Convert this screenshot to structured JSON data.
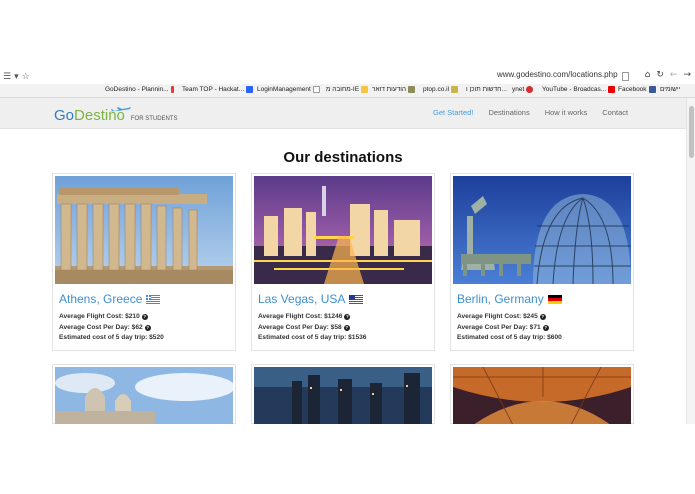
{
  "browser": {
    "url": "www.godestino.com/locations.php",
    "bookmarks": [
      "GoDestino - Plannin...",
      "Team TOP - Hackat...",
      "LoginManagement",
      "מחובה מ-IE",
      "הודעות דואר",
      "ptop.co.il",
      "חדשות תוכן ו...",
      "ynet",
      "YouTube - Broadcas...",
      "Facebook",
      "יישומים"
    ]
  },
  "nav": {
    "logo_go": "Go",
    "logo_destino": "Destino",
    "logo_tagline": "FOR STUDENTS",
    "links": [
      {
        "label": "Get Started!",
        "active": true
      },
      {
        "label": "Destinations",
        "active": false
      },
      {
        "label": "How it works",
        "active": false
      },
      {
        "label": "Contact",
        "active": false
      }
    ]
  },
  "page": {
    "title": "Our destinations"
  },
  "destinations": [
    {
      "city": "Athens, Greece",
      "flight_label": "Average Flight Cost: $210",
      "day_label": "Average Cost Per Day: $62",
      "trip_label": "Estimated cost of 5 day trip: $520"
    },
    {
      "city": "Las Vegas, USA",
      "flight_label": "Average Flight Cost: $1246",
      "day_label": "Average Cost Per Day: $58",
      "trip_label": "Estimated cost of 5 day trip: $1536"
    },
    {
      "city": "Berlin, Germany",
      "flight_label": "Average Flight Cost: $245",
      "day_label": "Average Cost Per Day: $71",
      "trip_label": "Estimated cost of 5 day trip: $600"
    }
  ],
  "colors": {
    "accent": "#3f8fcf",
    "logo_green": "#7cb342",
    "nav_bg": "#efefef"
  }
}
